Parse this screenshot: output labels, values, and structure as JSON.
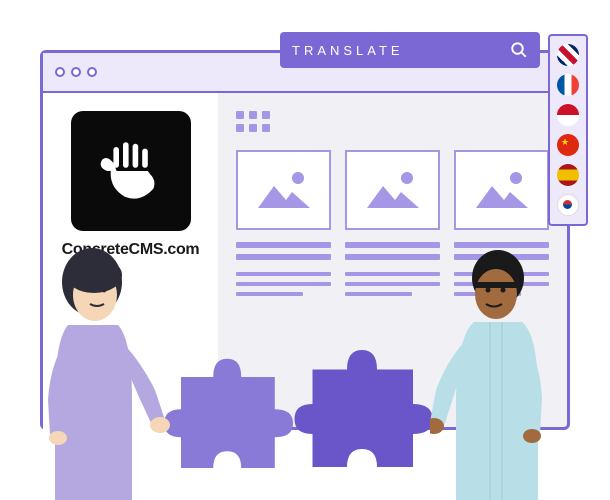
{
  "translate_bar": {
    "label": "TRANSLATE"
  },
  "logo": {
    "text": "ConcreteCMS.com"
  },
  "languages": [
    {
      "name": "uk"
    },
    {
      "name": "fr"
    },
    {
      "name": "id"
    },
    {
      "name": "cn"
    },
    {
      "name": "es"
    },
    {
      "name": "kr"
    }
  ],
  "colors": {
    "primary": "#7b68d4",
    "light": "#a596e6",
    "dark_puzzle": "#6a56c8",
    "light_puzzle": "#8a7ad8"
  }
}
